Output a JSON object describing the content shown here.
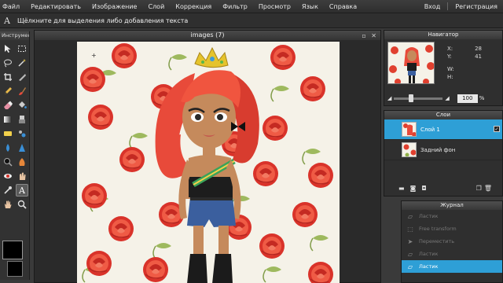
{
  "menu": {
    "items": [
      "Файл",
      "Редактировать",
      "Изображение",
      "Слой",
      "Коррекция",
      "Фильтр",
      "Просмотр",
      "Язык",
      "Справка"
    ],
    "login": "Вход",
    "register": "Регистрация"
  },
  "options_bar": {
    "tool_glyph": "A",
    "hint": "Щёлкните для выделения либо добавления текста"
  },
  "tools_panel": {
    "title": "Инструмент",
    "tools": [
      "move-icon",
      "marquee-icon",
      "lasso-icon",
      "wand-icon",
      "crop-icon",
      "slice-icon",
      "pencil-icon",
      "brush-icon",
      "eraser-icon",
      "bucket-icon",
      "gradient-icon",
      "clone-icon",
      "sponge-icon",
      "blur-icon",
      "drop-icon",
      "sharpen-icon",
      "dodge-icon",
      "burn-icon",
      "red-eye-icon",
      "smudge-icon",
      "picker-icon",
      "text-icon",
      "hand-icon",
      "zoom-icon"
    ],
    "active_tool": "text-icon",
    "foreground_color": "#000000",
    "background_color": "#000000"
  },
  "document": {
    "title": "images (7)",
    "window_buttons": "▫ ✕"
  },
  "navigator": {
    "title": "Навигатор",
    "x_label": "X:",
    "x_value": "28",
    "y_label": "Y:",
    "y_value": "41",
    "w_label": "W:",
    "w_value": "",
    "h_label": "H:",
    "h_value": "",
    "zoom_value": "100",
    "zoom_unit": "%",
    "zoom_slider_fraction": 0.33
  },
  "layers": {
    "title": "Слои",
    "items": [
      {
        "name": "Слой 1",
        "active": true,
        "visible": true
      },
      {
        "name": "Задний фон",
        "active": false,
        "visible": false
      }
    ]
  },
  "history": {
    "title": "Журнал",
    "items": [
      {
        "label": "Ластик",
        "active": false
      },
      {
        "label": "Free transform",
        "active": false
      },
      {
        "label": "Переместить",
        "active": false
      },
      {
        "label": "Ластик",
        "active": false
      },
      {
        "label": "Ластик",
        "active": true
      }
    ]
  },
  "colors": {
    "accent": "#2e9fd6",
    "rose": "#e53a2c",
    "leaf": "#7fa83a",
    "hair": "#e84a3a"
  }
}
